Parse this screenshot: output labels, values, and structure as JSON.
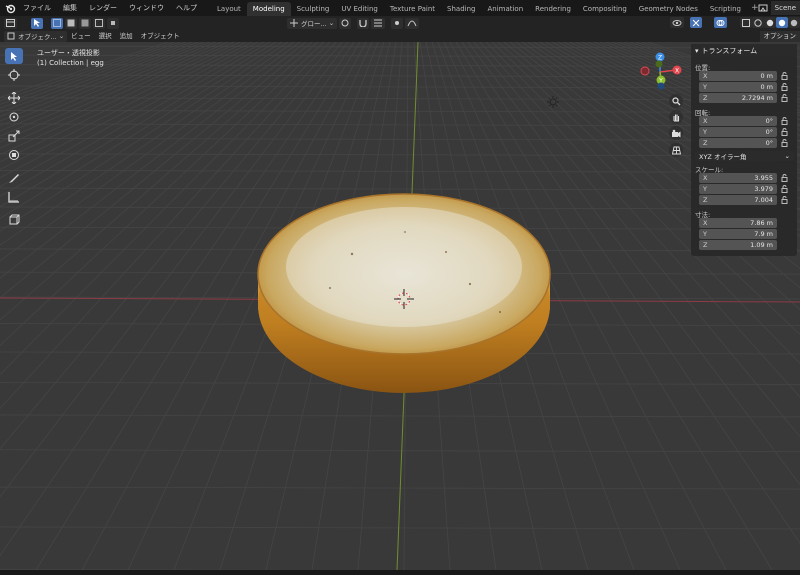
{
  "menu": [
    "ファイル",
    "編集",
    "レンダー",
    "ウィンドウ",
    "ヘルプ"
  ],
  "tabs": [
    {
      "label": "Layout",
      "active": false
    },
    {
      "label": "Modeling",
      "active": true
    },
    {
      "label": "Sculpting",
      "active": false
    },
    {
      "label": "UV Editing",
      "active": false
    },
    {
      "label": "Texture Paint",
      "active": false
    },
    {
      "label": "Shading",
      "active": false
    },
    {
      "label": "Animation",
      "active": false
    },
    {
      "label": "Rendering",
      "active": false
    },
    {
      "label": "Compositing",
      "active": false
    },
    {
      "label": "Geometry Nodes",
      "active": false
    },
    {
      "label": "Scripting",
      "active": false
    }
  ],
  "scene_label": "Scene",
  "header": {
    "transform_orientation": "グロー...",
    "options_label": "オプション",
    "mode_label": "オブジェク...",
    "menu": [
      "ビュー",
      "選択",
      "追加",
      "オブジェクト"
    ]
  },
  "viewport": {
    "view_name": "ユーザー・透視投影",
    "collection_info": "(1) Collection | egg"
  },
  "npanel": {
    "title": "トランスフォーム",
    "location_label": "位置:",
    "location": [
      {
        "axis": "X",
        "value": "0 m"
      },
      {
        "axis": "Y",
        "value": "0 m"
      },
      {
        "axis": "Z",
        "value": "2.7294 m"
      }
    ],
    "rotation_label": "回転:",
    "rotation": [
      {
        "axis": "X",
        "value": "0°"
      },
      {
        "axis": "Y",
        "value": "0°"
      },
      {
        "axis": "Z",
        "value": "0°"
      }
    ],
    "rotation_mode": "XYZ オイラー角",
    "scale_label": "スケール:",
    "scale": [
      {
        "axis": "X",
        "value": "3.955"
      },
      {
        "axis": "Y",
        "value": "3.979"
      },
      {
        "axis": "Z",
        "value": "7.004"
      }
    ],
    "dimensions_label": "寸法:",
    "dimensions": [
      {
        "axis": "X",
        "value": "7.86 m"
      },
      {
        "axis": "Y",
        "value": "7.9 m"
      },
      {
        "axis": "Z",
        "value": "1.09 m"
      }
    ]
  },
  "gizmo": {
    "x": "X",
    "y": "Y",
    "z": "Z"
  },
  "colors": {
    "accent": "#4772b3",
    "x_axis": "#e0474f",
    "y_axis": "#8bbd2c",
    "z_axis": "#3b8fe6",
    "viewport_bg": "#393939"
  }
}
